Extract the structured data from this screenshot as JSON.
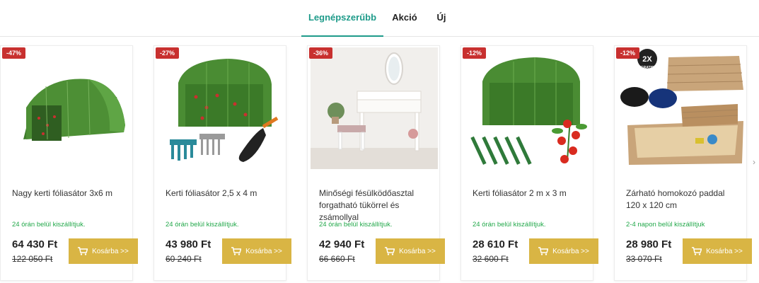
{
  "tabs": [
    {
      "label": "Legnépszerűbb",
      "active": true
    },
    {
      "label": "Akció",
      "active": false
    },
    {
      "label": "Új",
      "active": false
    }
  ],
  "colors": {
    "accent": "#1e9b8a",
    "badge": "#c8302f",
    "cart_button": "#d9b544",
    "delivery": "#22a84a"
  },
  "products": [
    {
      "badge": "-47%",
      "title": "Nagy kerti fóliasátor 3x6 m",
      "delivery": "24 órán belül kiszállítjuk.",
      "price": "64 430 Ft",
      "old_price": "122 050 Ft",
      "cart_label": "Kosárba >>",
      "image": "greenhouse-photo"
    },
    {
      "badge": "-27%",
      "title": "Kerti fóliasátor 2,5 x 4 m",
      "delivery": "24 órán belül kiszállítjuk.",
      "price": "43 980 Ft",
      "old_price": "60 240 Ft",
      "cart_label": "Kosárba >>",
      "image": "greenhouse-tools-photo"
    },
    {
      "badge": "-36%",
      "title": "Minőségi fésülködőasztal forgatható tükörrel és zsámollyal",
      "delivery": "24 órán belül kiszállítjuk.",
      "price": "42 940 Ft",
      "old_price": "66 660 Ft",
      "cart_label": "Kosárba >>",
      "image": "dressing-table-photo"
    },
    {
      "badge": "-12%",
      "title": "Kerti fóliasátor 2 m x 3 m",
      "delivery": "24 órán belül kiszállítjuk.",
      "price": "28 610 Ft",
      "old_price": "32 600 Ft",
      "cart_label": "Kosárba >>",
      "image": "greenhouse-tomato-photo"
    },
    {
      "badge": "-12%",
      "title": "Zárható homokozó paddal 120 x 120 cm",
      "delivery": "2-4 napon belül kiszállítjuk",
      "price": "28 980 Ft",
      "old_price": "33 070 Ft",
      "cart_label": "Kosárba >>",
      "image": "sandbox-photo",
      "image_badge": "2X",
      "image_badge_sub": "GRATIS"
    }
  ],
  "carousel": {
    "next_icon": "chevron-right-icon"
  }
}
